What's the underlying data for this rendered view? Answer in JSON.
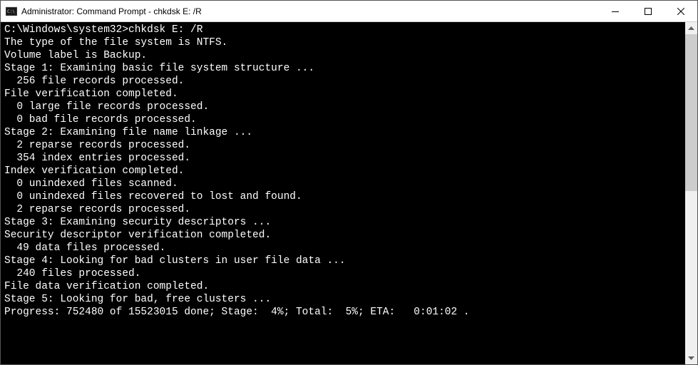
{
  "window": {
    "title": "Administrator: Command Prompt - chkdsk  E: /R"
  },
  "prompt": {
    "path": "C:\\Windows\\system32>",
    "command": "chkdsk E: /R"
  },
  "lines": {
    "l1": "The type of the file system is NTFS.",
    "l2": "Volume label is Backup.",
    "l3": "",
    "l4": "Stage 1: Examining basic file system structure ...",
    "l5": "  256 file records processed.",
    "l6": "File verification completed.",
    "l7": "  0 large file records processed.",
    "l8": "  0 bad file records processed.",
    "l9": "",
    "l10": "Stage 2: Examining file name linkage ...",
    "l11": "  2 reparse records processed.",
    "l12": "  354 index entries processed.",
    "l13": "Index verification completed.",
    "l14": "  0 unindexed files scanned.",
    "l15": "  0 unindexed files recovered to lost and found.",
    "l16": "  2 reparse records processed.",
    "l17": "",
    "l18": "Stage 3: Examining security descriptors ...",
    "l19": "Security descriptor verification completed.",
    "l20": "  49 data files processed.",
    "l21": "",
    "l22": "Stage 4: Looking for bad clusters in user file data ...",
    "l23": "  240 files processed.",
    "l24": "File data verification completed.",
    "l25": "",
    "l26": "Stage 5: Looking for bad, free clusters ...",
    "l27": "Progress: 752480 of 15523015 done; Stage:  4%; Total:  5%; ETA:   0:01:02 ."
  }
}
